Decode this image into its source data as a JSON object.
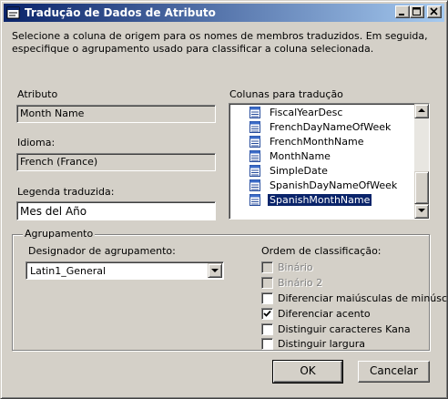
{
  "window": {
    "title": "Tradução de Dados de Atributo",
    "icon": "dialog-icon"
  },
  "titlebar_buttons": {
    "minimize": "minimize-icon",
    "maximize": "maximize-icon",
    "close": "close-icon"
  },
  "description": "Selecione a coluna de origem para os nomes de membros traduzidos. Em seguida, especifique o agrupamento usado para classificar a coluna selecionada.",
  "attribute": {
    "label": "Atributo",
    "value": "Month Name"
  },
  "language": {
    "label": "Idioma:",
    "value": "French (France)"
  },
  "caption": {
    "label": "Legenda traduzida:",
    "value": "Mes del Año"
  },
  "columns": {
    "label": "Colunas para tradução",
    "item_icon": "column-icon",
    "items": [
      {
        "label": "FiscalYearDesc"
      },
      {
        "label": "FrenchDayNameOfWeek"
      },
      {
        "label": "FrenchMonthName"
      },
      {
        "label": "MonthName"
      },
      {
        "label": "SimpleDate"
      },
      {
        "label": "SpanishDayNameOfWeek"
      },
      {
        "label": "SpanishMonthName",
        "selected": true
      }
    ]
  },
  "grouping": {
    "legend": "Agrupamento",
    "collation_label": "Designador de agrupamento:",
    "collation_value": "Latin1_General",
    "sort_label": "Ordem de classificação:",
    "options": [
      {
        "label": "Binário",
        "checked": false,
        "enabled": false
      },
      {
        "label": "Binário 2",
        "checked": false,
        "enabled": false
      },
      {
        "label": "Diferenciar maiúsculas de minúscu",
        "checked": false,
        "enabled": true
      },
      {
        "label": "Diferenciar acento",
        "checked": true,
        "enabled": true
      },
      {
        "label": "Distinguir caracteres Kana",
        "checked": false,
        "enabled": true
      },
      {
        "label": "Distinguir largura",
        "checked": false,
        "enabled": true
      }
    ]
  },
  "buttons": {
    "ok": "OK",
    "cancel": "Cancelar"
  }
}
